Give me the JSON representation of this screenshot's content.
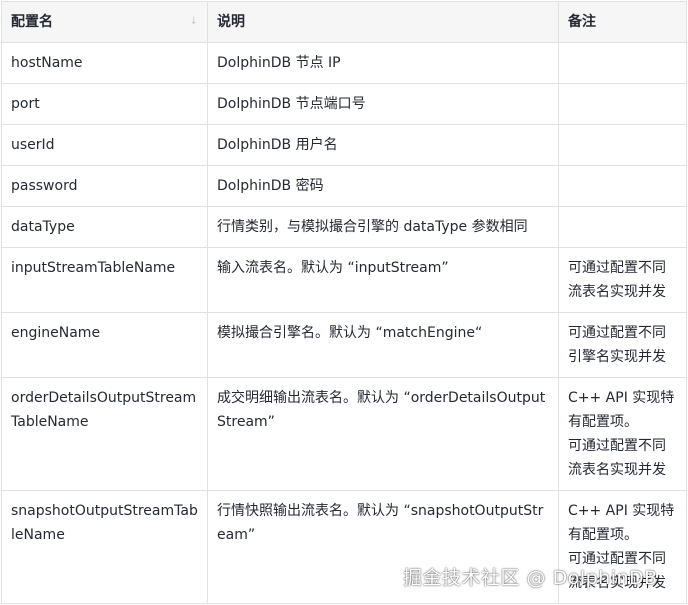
{
  "headers": [
    "配置名",
    "说明",
    "备注"
  ],
  "sort_indicator": "↓",
  "rows": [
    {
      "name": "hostName",
      "desc": "DolphinDB 节点 IP",
      "note": ""
    },
    {
      "name": "port",
      "desc": "DolphinDB 节点端口号",
      "note": ""
    },
    {
      "name": "userId",
      "desc": "DolphinDB 用户名",
      "note": ""
    },
    {
      "name": "password",
      "desc": "DolphinDB 密码",
      "note": ""
    },
    {
      "name": "dataType",
      "desc": "行情类别，与模拟撮合引擎的 dataType 参数相同",
      "note": ""
    },
    {
      "name": "inputStreamTableName",
      "desc": "输入流表名。默认为 “inputStream”",
      "note": "可通过配置不同流表名实现并发"
    },
    {
      "name": "engineName",
      "desc": "模拟撮合引擎名。默认为 “matchEngine“",
      "note": "可通过配置不同引擎名实现并发"
    },
    {
      "name": "orderDetailsOutputStreamTableName",
      "desc": "成交明细输出流表名。默认为 “orderDetailsOutputStream”",
      "note": "C++ API 实现特有配置项。\n可通过配置不同流表名实现并发"
    },
    {
      "name": "snapshotOutputStreamTableName",
      "desc": "行情快照输出流表名。默认为 “snapshotOutputStream”",
      "note": "C++ API 实现特有配置项。\n可通过配置不同流表名实现并发"
    }
  ],
  "watermark": "掘金技术社区 @ DolphinDB"
}
